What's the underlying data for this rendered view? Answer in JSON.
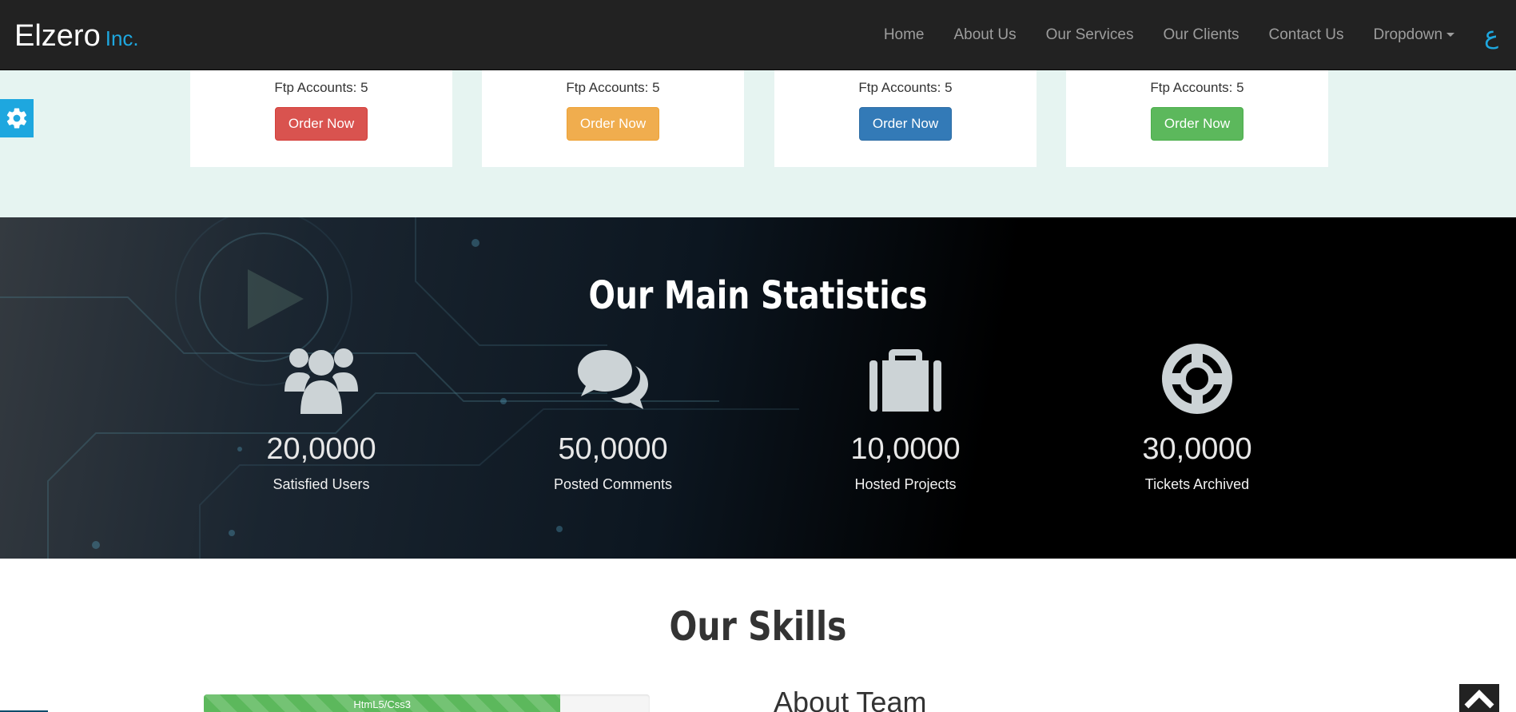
{
  "brand": {
    "name": "Elzero",
    "suffix": "Inc."
  },
  "nav": {
    "items": [
      {
        "label": "Home"
      },
      {
        "label": "About Us"
      },
      {
        "label": "Our Services"
      },
      {
        "label": "Our Clients"
      },
      {
        "label": "Contact Us"
      },
      {
        "label": "Dropdown"
      }
    ],
    "lang_toggle": "ع"
  },
  "plans": [
    {
      "ftp": "Ftp Accounts: 5",
      "button": "Order Now",
      "color": "#d9534f"
    },
    {
      "ftp": "Ftp Accounts: 5",
      "button": "Order Now",
      "color": "#f0ad4e"
    },
    {
      "ftp": "Ftp Accounts: 5",
      "button": "Order Now",
      "color": "#337ab7"
    },
    {
      "ftp": "Ftp Accounts: 5",
      "button": "Order Now",
      "color": "#5cb85c"
    }
  ],
  "settings_icon": "gear-icon",
  "stats": {
    "title": "Our Main Statistics",
    "items": [
      {
        "icon": "users-icon",
        "number": "20,0000",
        "label": "Satisfied Users"
      },
      {
        "icon": "comments-icon",
        "number": "50,0000",
        "label": "Posted Comments"
      },
      {
        "icon": "briefcase-icon",
        "number": "10,0000",
        "label": "Hosted Projects"
      },
      {
        "icon": "life-ring-icon",
        "number": "30,0000",
        "label": "Tickets Archived"
      }
    ]
  },
  "skills": {
    "title": "Our Skills",
    "bars": [
      {
        "label": "HtmL5/Css3",
        "value": 0.8
      }
    ],
    "about_team": "About Team"
  },
  "scroll_top_icon": "chevron-up-icon",
  "colors": {
    "accent": "#1ea7df",
    "navbar": "#222222",
    "pricing_bg": "#e6f4f1"
  }
}
